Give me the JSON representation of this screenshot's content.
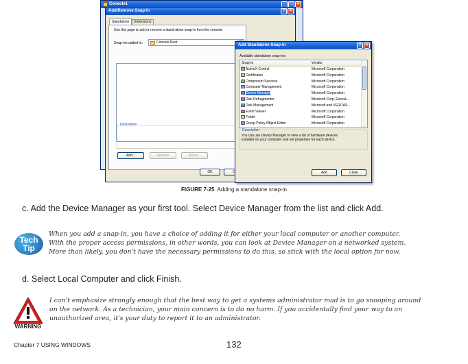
{
  "console_window": {
    "title": "Console1",
    "dialog_title": "Add/Remove Snap-in",
    "tabs": [
      "Standalone",
      "Extensions"
    ],
    "instruction": "Use this page to add or remove a stand-alone snap-in from the console.",
    "snapins_label": "Snap-ins added to:",
    "snapins_value": "Console Root",
    "description_label": "Description",
    "add_label": "Add...",
    "remove_label": "Remove",
    "about_label": "About...",
    "ok_label": "OK",
    "cancel_partial": "C"
  },
  "add_standalone": {
    "title": "Add Standalone Snap-in",
    "available_label": "Available standalone snap-ins:",
    "col_snapin": "Snap-in",
    "col_vendor": "Vendor",
    "rows": [
      {
        "name": "ActiveX Control",
        "vendor": "Microsoft Corporation",
        "icon": "activex-icon"
      },
      {
        "name": "Certificates",
        "vendor": "Microsoft Corporation",
        "icon": "certificates-icon"
      },
      {
        "name": "Component Services",
        "vendor": "Microsoft Corporation",
        "icon": "component-services-icon"
      },
      {
        "name": "Computer Management",
        "vendor": "Microsoft Corporation",
        "icon": "computer-management-icon"
      },
      {
        "name": "Device Manager",
        "vendor": "Microsoft Corporation",
        "icon": "device-manager-icon",
        "selected": true
      },
      {
        "name": "Disk Defragmenter",
        "vendor": "Microsoft Corp, Execut...",
        "icon": "defragmenter-icon"
      },
      {
        "name": "Disk Management",
        "vendor": "Microsoft and VERITAS...",
        "icon": "disk-management-icon"
      },
      {
        "name": "Event Viewer",
        "vendor": "Microsoft Corporation",
        "icon": "event-viewer-icon"
      },
      {
        "name": "Folder",
        "vendor": "Microsoft Corporation",
        "icon": "folder-icon"
      },
      {
        "name": "Group Policy Object Editor",
        "vendor": "Microsoft Corporation",
        "icon": "group-policy-icon"
      }
    ],
    "description_label": "Description",
    "description_text_line1": "You can use Device Manager to view a list of hardware devices",
    "description_text_line2": "installed on your computer and set properties for each device.",
    "add_label": "Add",
    "close_label": "Close"
  },
  "figure_caption": {
    "label": "FIGURE 7-25",
    "text": "Adding a standalone snap-in"
  },
  "step_c": "c. Add the Device Manager as your first tool. Select Device Manager from the list and click Add.",
  "tech_tip": {
    "badge_line1": "Tech",
    "badge_line2": "Tip",
    "line1": "When you add a snap-in, you have a choice of adding it for either your local computer or another computer.",
    "line2": "With the proper access permissions, in other words, you can look at Device Manager on a networked system.",
    "line3": "More than likely, you don't have the necessary permissions to do this, so stick with the local option for now."
  },
  "step_d": "d. Select Local Computer and click Finish.",
  "warning": {
    "badge": "WARNING",
    "line1": "I can't emphasize strongly enough that the best way to get a systems administrator mad is to go snooping around",
    "line2": "on the network. As a technician, your main concern is to do no harm. If you accidentally find your way to an",
    "line3": "unauthorized area, it's your duty to report it to an administrator."
  },
  "footer": {
    "chapter": "Chapter 7 USING WINDOWS",
    "page": "132"
  },
  "colors": {
    "xp_title_blue": "#1b5fd1",
    "selection_blue": "#316ac5",
    "dialog_bg": "#ece9d8",
    "warning_red": "#d42020",
    "tech_tip_blue": "#1e5fa8"
  }
}
